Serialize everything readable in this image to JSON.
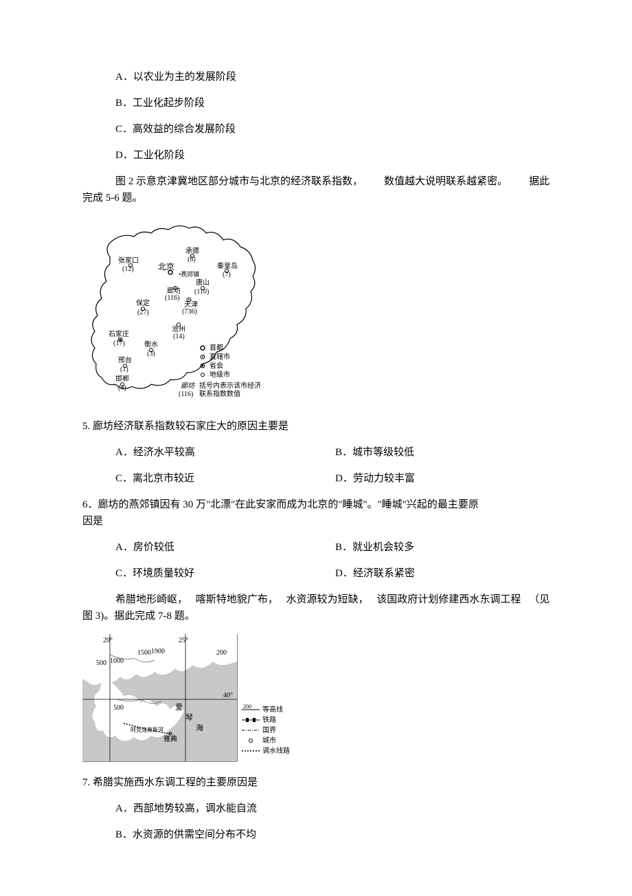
{
  "q_prev_options": {
    "A": "A．以农业为主的发展阶段",
    "B": "B．工业化起步阶段",
    "C": "C．高效益的综合发展阶段",
    "D": "D．工业化阶段"
  },
  "intro_5_6_seg1": "图 2 示意京津冀地区部分城市与北京的经济联系指数，",
  "intro_5_6_seg2": "数值越大说明联系越紧密。",
  "intro_5_6_seg3": "据此",
  "intro_5_6_line2": "完成 5-6 题。",
  "figure2": {
    "cities": [
      {
        "name": "张家口",
        "value": "(12)"
      },
      {
        "name": "北京",
        "value": ""
      },
      {
        "name": "承德",
        "value": "(6)"
      },
      {
        "name": "秦皇岛",
        "value": "(7)"
      },
      {
        "name": "唐山",
        "value": "(110)"
      },
      {
        "name": "廊坊",
        "value": "(116)"
      },
      {
        "name": "天津",
        "value": "(736)"
      },
      {
        "name": "保定",
        "value": "(27)"
      },
      {
        "name": "沧州",
        "value": "(14)"
      },
      {
        "name": "石家庄",
        "value": "(17)"
      },
      {
        "name": "衡水",
        "value": "(3)"
      },
      {
        "name": "邢台",
        "value": "(1)"
      },
      {
        "name": "邯郸",
        "value": "(4)"
      }
    ],
    "yanjiao": "燕郊镇",
    "legend": {
      "capital": "首都",
      "municipality": "直辖市",
      "provincial_capital": "省会",
      "prefecture": "地级市",
      "note_city": "廊坊",
      "note_value": "(116)",
      "note_text1": "括号内表示该市经济",
      "note_text2": "联系指数数值"
    }
  },
  "q5": {
    "stem": "5. 廊坊经济联系指数较石家庄大的原因主要是",
    "A": "A．经济水平较高",
    "B": "B．城市等级较低",
    "C": "C．离北京市较近",
    "D": "D．劳动力较丰富"
  },
  "q6": {
    "stem_line1": "6．廊坊的燕郊镇因有 30 万\"北漂\"在此安家而成为北京的\"睡城\"。\"睡城\"兴起的最主要原",
    "stem_line2": "因是",
    "A": "A．房价较低",
    "B": "B．就业机会较多",
    "C": "C．环境质量较好",
    "D": "D．经济联系紧密"
  },
  "intro_7_8_seg1": "希腊地形崎岖，",
  "intro_7_8_seg2": "喀斯特地貌广布，",
  "intro_7_8_seg3": "水资源较为短缺，",
  "intro_7_8_seg4": "该国政府计划修建西水东调工程",
  "intro_7_8_seg5": "（见",
  "intro_7_8_line2": "图 3)。据此完成   7-8 题。",
  "figure3": {
    "lon20": "20°",
    "lon25": "25°",
    "lat40": "40°",
    "contours": [
      "200",
      "500",
      "1000",
      "1500",
      "1900"
    ],
    "sea_labels": [
      "爱",
      "琴",
      "海"
    ],
    "city": "雅典",
    "river_label": "阿克洛奥斯河",
    "legend": {
      "contour": "等高线",
      "contour_value": "200",
      "railway": "铁路",
      "border": "国界",
      "city": "城市",
      "route": "调水线路"
    }
  },
  "q7": {
    "stem": "7. 希腊实施西水东调工程的主要原因是",
    "A": "A．西部地势较高，调水能自流",
    "B": "B．水资源的供需空间分布不均"
  }
}
